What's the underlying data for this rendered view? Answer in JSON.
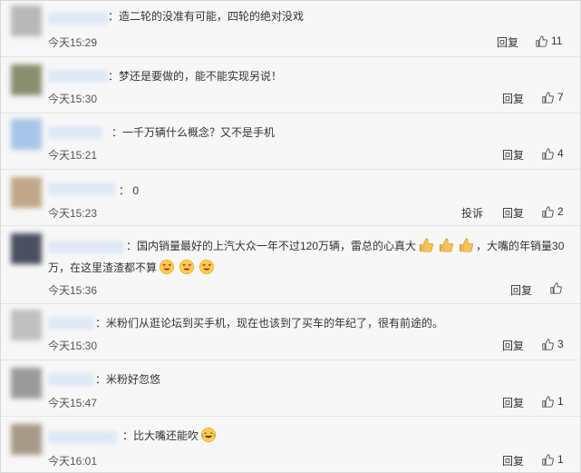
{
  "comments": [
    {
      "text": "：造二轮的没准有可能，四轮的绝对没戏",
      "time": "今天15:29",
      "reply": "回复",
      "likes": "11"
    },
    {
      "text": "：梦还是要做的，能不能实现另说！",
      "time": "今天15:30",
      "reply": "回复",
      "likes": "7"
    },
    {
      "text": "：一千万辆什么概念？又不是手机",
      "time": "今天15:21",
      "reply": "回复",
      "likes": "4"
    },
    {
      "text": "： 0",
      "time": "今天15:23",
      "report": "投诉",
      "reply": "回复",
      "likes": "2"
    },
    {
      "text_a": "：国内销量最好的上汽大众一年不过120万辆，雷总的心真大",
      "text_b": "，大嘴的年销量30",
      "text_c": "万，在这里渣渣都不算",
      "time": "今天15:36",
      "reply": "回复",
      "likes": ""
    },
    {
      "text": "：米粉们从逛论坛到买手机，现在也该到了买车的年纪了，很有前途的。",
      "time": "今天15:30",
      "reply": "回复",
      "likes": "3"
    },
    {
      "text": "：米粉好忽悠",
      "time": "今天15:47",
      "reply": "回复",
      "likes": "1"
    },
    {
      "text": "：比大嘴还能吹",
      "time": "今天16:01",
      "reply": "回复",
      "likes": "1"
    }
  ],
  "icons": {
    "like": "thumbs-up-icon",
    "thumb_emoji": "thumbs-up-emoji",
    "love_emoji": "heart-eyes-emoji",
    "laugh_emoji": "laughing-crying-emoji"
  },
  "colors": {
    "avatar_1": "#b8b8b8",
    "avatar_2": "#8a8f6e",
    "avatar_3": "#a8c4e8",
    "avatar_4": "#c0a888",
    "avatar_5": "#4a5060",
    "avatar_6": "#bfbfbf",
    "avatar_7": "#9a9a9a",
    "avatar_8": "#a89a88"
  }
}
